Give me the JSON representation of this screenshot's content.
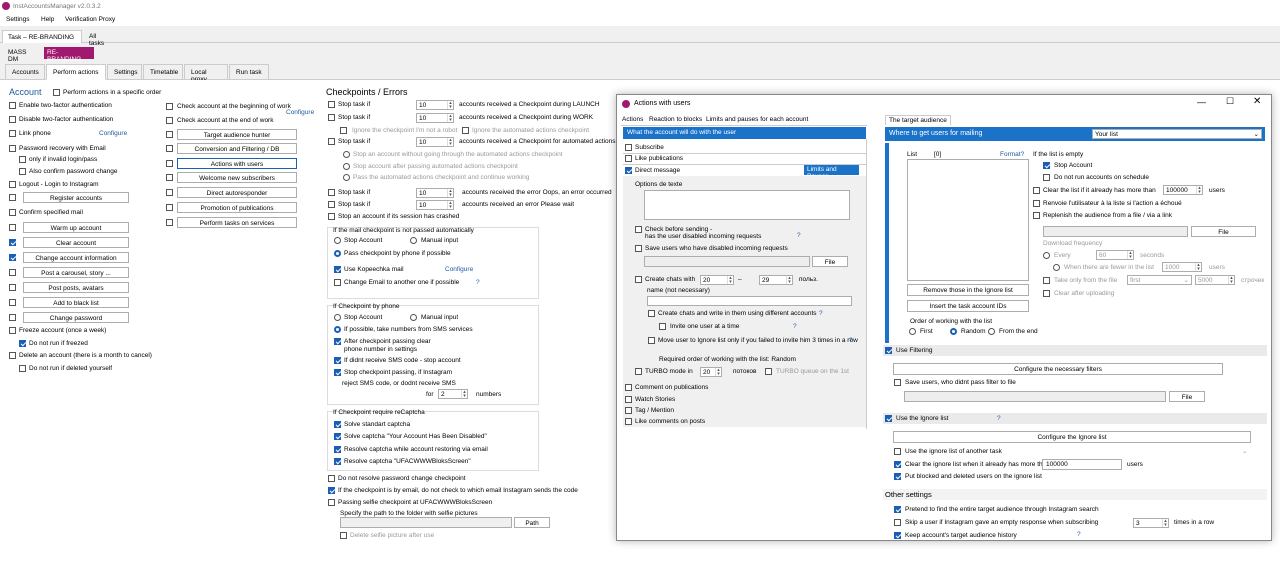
{
  "app": {
    "title": "InstAccountsManager v2.0.3.2"
  },
  "menu": [
    "Settings",
    "Help",
    "Verification Proxy"
  ],
  "task_tabs": [
    "Task – RE-BRANDING",
    "All tasks"
  ],
  "mass_dm": {
    "label": "MASS DM",
    "badge": "RE-BRANDING"
  },
  "sub_tabs": [
    "Accounts",
    "Perform actions",
    "Settings",
    "Timetable",
    "Local proxy",
    "Run task"
  ],
  "account": {
    "heading": "Account",
    "perform_specific": "Perform actions in a specific order",
    "items": [
      {
        "label": "Enable two-factor authentication",
        "checked": false
      },
      {
        "label": "Disable two-factor authentication",
        "checked": false
      },
      {
        "label": "Link phone",
        "checked": false,
        "link": "Configure"
      },
      {
        "label": "Password recovery with Email",
        "checked": false
      },
      {
        "label": "only if invalid login/pass",
        "checked": false
      },
      {
        "label": "Also confirm password change",
        "checked": false
      },
      {
        "label": "Logout - Login to Instagram",
        "checked": false
      },
      {
        "label": "",
        "checked": false,
        "button": "Register accounts"
      },
      {
        "label": "Confirm specified mail",
        "checked": false
      },
      {
        "label": "",
        "checked": false,
        "button": "Warm up account"
      },
      {
        "label": "",
        "checked": true,
        "button": "Clear account"
      },
      {
        "label": "",
        "checked": true,
        "button": "Change account information"
      },
      {
        "label": "",
        "checked": false,
        "button": "Post a carousel, story ..."
      },
      {
        "label": "",
        "checked": false,
        "button": "Post posts, avatars"
      },
      {
        "label": "",
        "checked": false,
        "button": "Add to black list"
      },
      {
        "label": "",
        "checked": false,
        "button": "Change password"
      },
      {
        "label": "Freeze account (once a week)",
        "checked": false
      },
      {
        "label": "Do not run if freezed",
        "checked": true
      },
      {
        "label": "Delete an account (there is a month to cancel)",
        "checked": false
      },
      {
        "label": "Do not run if deleted yourself",
        "checked": false
      }
    ]
  },
  "middle": {
    "check_begin": "Check account at the beginning of work",
    "configure": "Configure",
    "check_end": "Check account at the end of work",
    "buttons": [
      "Target audience hunter",
      "Conversion and Filtering / DB",
      "Actions with users",
      "Welcome new subscribers",
      "Direct autoresponder",
      "Promotion of publications",
      "Perform tasks on services"
    ]
  },
  "checkpoints": {
    "heading": "Checkpoints / Errors",
    "stop_if": "Stop task if",
    "r1": "accounts received a Checkpoint during LAUNCH",
    "r2": "accounts received a Checkpoint during WORK",
    "ignore_robot": "Ignore the checkpoint I'm not a robot",
    "ignore_auto": "Ignore the automated actions checkpoint",
    "r3": "accounts received a Checkpoint for automated actions",
    "opt1": "Stop an account without going through the automated actions checkpoint",
    "opt2": "Stop account after passing automated actions checkpoint",
    "opt3": "Pass the automated actions checkpoint and continue working",
    "r4": "accounts received the error Oops, an error occurred",
    "r5": "accounts received an error Please wait",
    "val": "10",
    "stop_session": "Stop an account if its session has crashed",
    "mail_group": "If the mail checkpoint is not passed automatically",
    "stop_account": "Stop Account",
    "manual": "Manual input",
    "pass_phone": "Pass checkpoint by phone if possible",
    "use_kopeechka": "Use Kopeechka mail",
    "configure": "Configure",
    "change_email": "Change Email to another one if possible",
    "q": "?",
    "phone_group": "If Checkpoint by phone",
    "take_numbers": "If possible, take numbers from SMS services",
    "after_clear": "After checkpoint passing clear",
    "after_clear2": "phone number in settings",
    "no_sms": "If didnt receive SMS code - stop account",
    "stop_passing": "Stop checkpoint passing, if Instagram",
    "reject_sms": "reject SMS code, or dodnt receive SMS",
    "for": "for",
    "for_val": "2",
    "numbers": "numbers",
    "recaptcha_group": "If Checkpoint require reCaptcha",
    "solve_std": "Solve standart captcha",
    "solve_disabled": "Solve captcha \"Your Account Has Been Disabled\"",
    "resolve_email": "Resolve captcha while account restoring via email",
    "resolve_ufac": "Resolve captcha \"UFACWWWBloksScreen\"",
    "no_resolve_pwd": "Do not resolve password change checkpoint",
    "email_check": "If the checkpoint is by email, do not check to which email Instagram sends the code",
    "selfie": "Passing selfie checkpoint at UFACWWWBloksScreen",
    "selfie_path": "Specify the path to the folder with selfie pictures",
    "path_btn": "Path",
    "delete_selfie": "Delete selfie picture after use"
  },
  "dialog": {
    "title": "Actions with users",
    "tabs": [
      "Actions",
      "Reaction to blocks",
      "Limits and pauses for each account"
    ],
    "what_bar": "What the account will do with the user",
    "subscribe": "Subscribe",
    "like_pub": "Like publications",
    "direct": "Direct message",
    "limits_btn": "Limits and Pauses",
    "options_text": "Options de texte",
    "check_before": "Check before sending -",
    "check_before2": "has the user disabled incoming requests",
    "save_users": "Save users who have disabled incoming requests",
    "file": "File",
    "create_chats": "Create chats with",
    "chats_from": "20",
    "chats_to": "29",
    "polz": "польз.",
    "chat_name": "name (not necessary)",
    "create_write": "Create chats and write in them using different accounts",
    "invite_one": "Invite one user at a time",
    "move_ignore": "Move user to Ignore list only if you failed to invite him 3 times in a row",
    "required_order": "Required order of working with the list: Random",
    "turbo": "TURBO mode in",
    "turbo_val": "20",
    "potokov": "потоков",
    "turbo_queue": "TURBO queue on the 1st",
    "comment_pub": "Comment on publications",
    "watch_stories": "Watch Stories",
    "tag_mention": "Tag / Mention",
    "like_comments": "Like comments on posts",
    "q": "?",
    "target_tab": "The target audience",
    "where_bar": "Where to get users for mailing",
    "where_select": "Your list",
    "list": "List",
    "list_count": "[0]",
    "format": "Format?",
    "remove_ignore": "Remove those in the Ignore list",
    "insert_ids": "Insert the task account IDs",
    "order_label": "Order of working with the list",
    "first": "First",
    "random": "Random",
    "from_end": "From the end",
    "if_empty": "If the list is empty",
    "stop_account": "Stop Account",
    "no_schedule": "Do not run accounts on schedule",
    "clear_more": "Clear the list if it already has more than",
    "clear_val": "100000",
    "users": "users",
    "renvoie": "Renvoie l'utilisateur à la liste si l'action a échoué",
    "replenish": "Replenish the audience from a file / via a link",
    "download_freq": "Download frequency",
    "every": "Every",
    "every_val": "60",
    "seconds": "seconds",
    "fewer": "When there are fewer in the list",
    "fewer_val": "1000",
    "take_only": "Take only from the file",
    "first_opt": "first",
    "take_val": "5000",
    "strok": "строчек",
    "clear_after": "Clear after uploading",
    "use_filtering": "Use Filtering",
    "config_filters": "Configure the necessary filters",
    "save_no_filter": "Save users, who didnt pass filter to file",
    "use_ignore": "Use the Ignore list",
    "config_ignore": "Configure the Ignore list",
    "use_another": "Use the ignore list of another task",
    "clear_ignore": "Clear the ignore list when it already has more than",
    "clear_ignore_val": "100000",
    "put_blocked": "Put blocked and deleted users on the ignore list",
    "other": "Other settings",
    "pretend": "Pretend to find the entire target audience through Instagram search",
    "skip_user": "Skip a user if Instagram gave an empty response when subscribing",
    "skip_val": "3",
    "times_row": "times in a row",
    "keep_history": "Keep account's target audience history"
  },
  "colors": {
    "accent": "#1a73c9",
    "brand": "#a0196e"
  }
}
